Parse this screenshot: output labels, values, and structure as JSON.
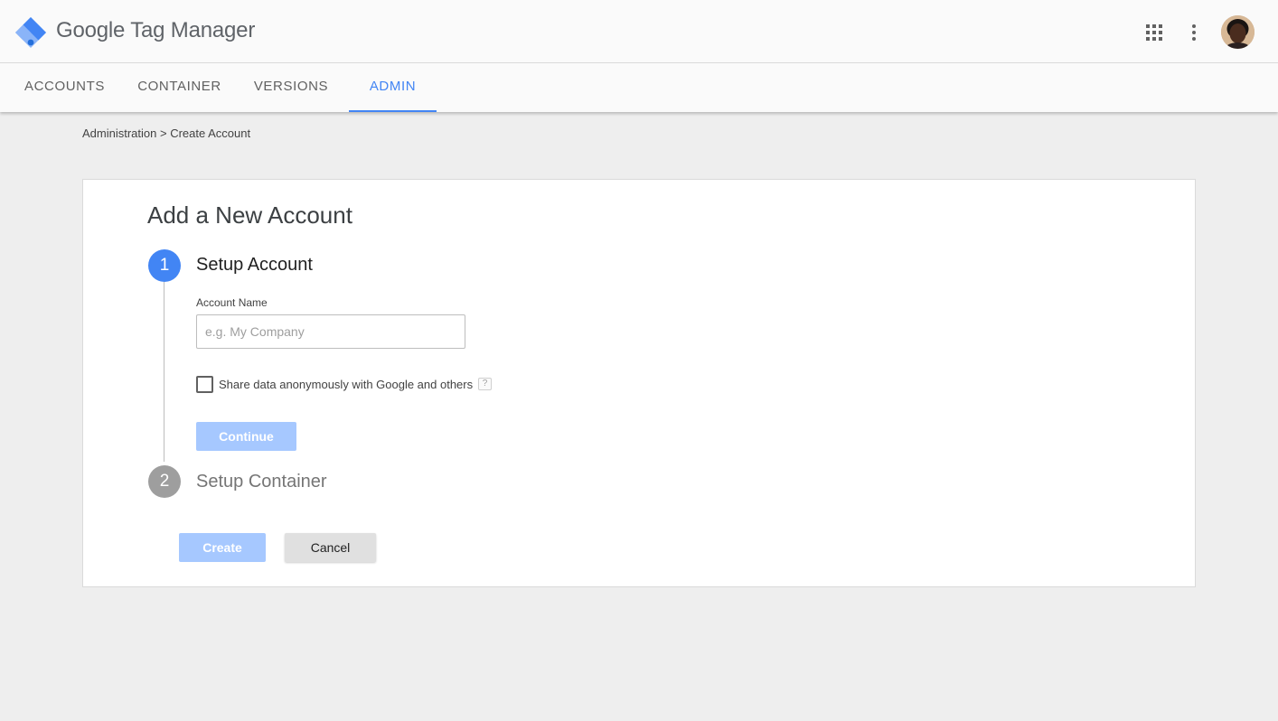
{
  "app": {
    "title": "Google Tag Manager",
    "brand_colors": {
      "accent": "#4285f4",
      "logo_light": "#8ab4f8",
      "logo_dark": "#4285f4",
      "logo_mid": "#246fdb"
    }
  },
  "header": {
    "icons": [
      "apps-grid-icon",
      "more-vert-icon",
      "avatar"
    ]
  },
  "nav": {
    "tabs": [
      {
        "label": "ACCOUNTS",
        "active": false
      },
      {
        "label": "CONTAINER",
        "active": false
      },
      {
        "label": "VERSIONS",
        "active": false
      },
      {
        "label": "ADMIN",
        "active": true
      }
    ]
  },
  "breadcrumb": {
    "parent": "Administration",
    "separator": ">",
    "current": "Create Account"
  },
  "form": {
    "title": "Add a New Account",
    "step1": {
      "number": "1",
      "title": "Setup Account",
      "account_name_label": "Account Name",
      "account_name_value": "",
      "account_name_placeholder": "e.g. My Company",
      "share_data_label": "Share data anonymously with Google and others",
      "share_data_checked": false,
      "help_glyph": "?",
      "continue_label": "Continue"
    },
    "step2": {
      "number": "2",
      "title": "Setup Container"
    },
    "create_label": "Create",
    "cancel_label": "Cancel"
  }
}
